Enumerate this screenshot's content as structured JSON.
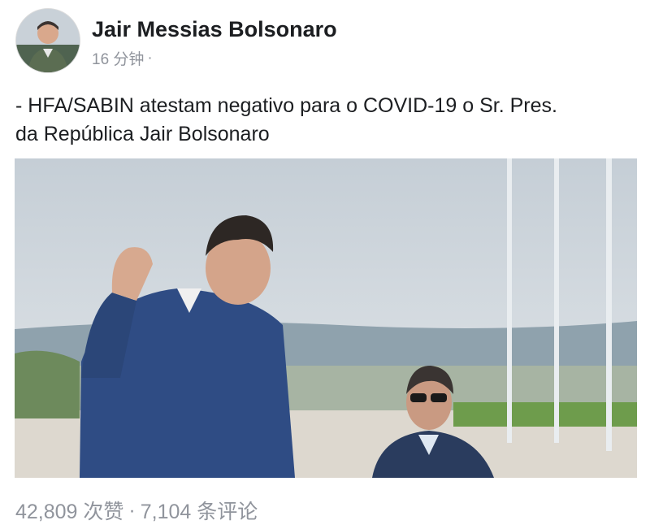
{
  "post": {
    "author_name": "Jair Messias Bolsonaro",
    "timestamp": "16 分钟",
    "separator": "·",
    "text_line1": "- HFA/SABIN atestam negativo para o COVID-19 o Sr. Pres.",
    "text_line2": "da República Jair Bolsonaro"
  },
  "stats": {
    "likes": "42,809 次赞",
    "separator": "·",
    "comments": "7,104 条评论"
  },
  "icons": {
    "privacy": "globe-icon"
  }
}
